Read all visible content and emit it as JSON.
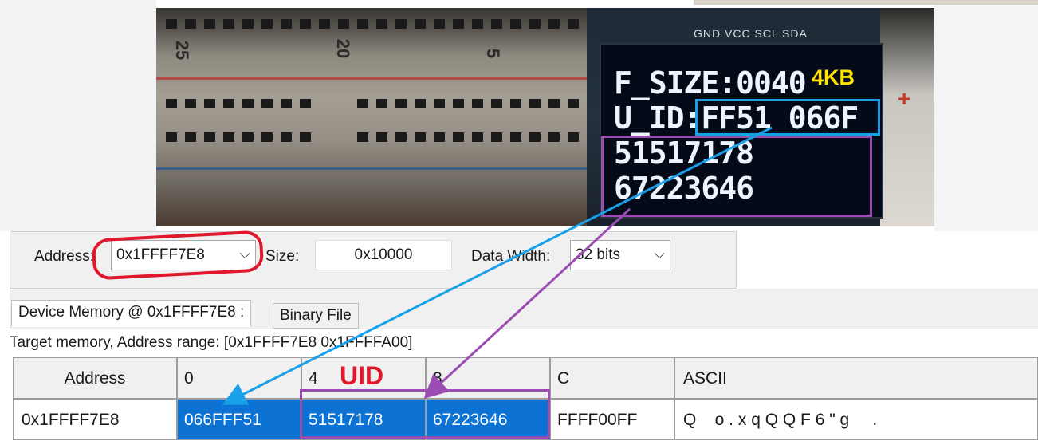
{
  "photo": {
    "breadboard_numbers": [
      "25",
      "20",
      "5"
    ],
    "oled_pins": "GND VCC SCL SDA",
    "oled_lines": [
      "F_SIZE:0040",
      "U_ID:FF51 066F",
      "51517178",
      "67223646"
    ],
    "flash_annotation": "4KB"
  },
  "toolbar": {
    "address_label": "Address:",
    "address_value": "0x1FFFF7E8",
    "size_label": "Size:",
    "size_value": "0x10000",
    "data_width_label": "Data Width:",
    "data_width_value": "32 bits"
  },
  "tabs": [
    {
      "label": "Device Memory @ 0x1FFFF7E8 :",
      "active": true
    },
    {
      "label": "Binary File",
      "active": false
    }
  ],
  "info_bar": "Target memory, Address range: [0x1FFFF7E8 0x1FFFFA00]",
  "grid": {
    "headers": [
      "Address",
      "0",
      "4",
      "8",
      "C",
      "ASCII"
    ],
    "rows": [
      {
        "address": "0x1FFFF7E8",
        "cells": [
          "066FFF51",
          "51517178",
          "67223646",
          "FFFF00FF"
        ],
        "ascii": "Q    o . x q Q Q F 6 \" g     ."
      }
    ]
  },
  "annotations": {
    "uid_label": "UID"
  },
  "colors": {
    "selection": "#0c73d4",
    "annotation_red": "#e0182c",
    "annotation_blue": "#1aa0e8",
    "annotation_purple": "#9b4db3",
    "annotation_yellow": "#ffe400"
  },
  "icons": [
    "chevron-down-icon"
  ]
}
